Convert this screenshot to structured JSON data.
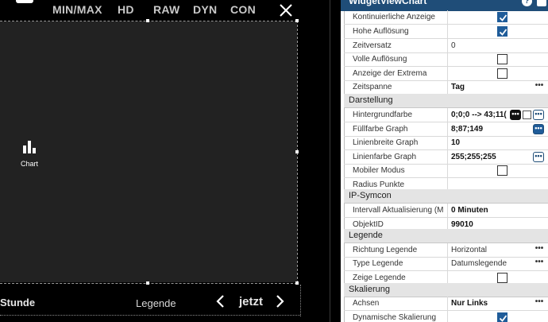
{
  "topbar": {
    "items": [
      "MIN/MAX",
      "HD",
      "RAW",
      "DYN",
      "CON"
    ]
  },
  "chart_icon": {
    "label": "Chart"
  },
  "bottombar": {
    "range_label": "Stunde",
    "legend_label": "Legende",
    "now_label": "jetzt"
  },
  "panel": {
    "title": "WidgetViewChart",
    "help": "?",
    "rows_top": [
      {
        "label": "Kontinuierliche Anzeige",
        "type": "checkbox",
        "checked": true
      },
      {
        "label": "Hohe Auflösung",
        "type": "checkbox",
        "checked": true
      },
      {
        "label": "Zeitversatz",
        "type": "text",
        "value": "0"
      },
      {
        "label": "Volle Auflösung",
        "type": "checkbox",
        "checked": false
      },
      {
        "label": "Anzeige der Extrema",
        "type": "checkbox",
        "checked": false
      },
      {
        "label": "Zeitspanne",
        "type": "select",
        "value": "Tag"
      }
    ],
    "section_darstellung": "Darstellung",
    "rows_darstellung": [
      {
        "label": "Hintergrundfarbe",
        "value": "0;0;0 --> 43;11("
      },
      {
        "label": "Füllfarbe Graph",
        "value": "8;87;149"
      },
      {
        "label": "Linienbreite Graph",
        "value": "10"
      },
      {
        "label": "Linienfarbe Graph",
        "value": "255;255;255"
      },
      {
        "label": "Mobiler Modus",
        "checked": false
      },
      {
        "label": "Radius Punkte",
        "value": ""
      }
    ],
    "section_ipsymcon": "IP-Symcon",
    "rows_ipsymcon": [
      {
        "label": "Intervall Aktualisierung (M",
        "value": "0 Minuten"
      },
      {
        "label": "ObjektID",
        "value": "99010"
      }
    ],
    "section_legende": "Legende",
    "rows_legende": [
      {
        "label": "Richtung Legende",
        "value": "Horizontal"
      },
      {
        "label": "Type Legende",
        "value": "Datumslegende"
      },
      {
        "label": "Zeige Legende",
        "checked": false
      }
    ],
    "section_skalierung": "Skalierung",
    "rows_skalierung": [
      {
        "label": "Achsen",
        "value": "Nur Links"
      },
      {
        "label": "Dynamische Skalierung",
        "checked": true
      }
    ],
    "more_glyph": "•••"
  },
  "colors": {
    "accent": "#1f4d78",
    "chart_bg": "#222222",
    "checkbox_on": "#1f5c99"
  }
}
